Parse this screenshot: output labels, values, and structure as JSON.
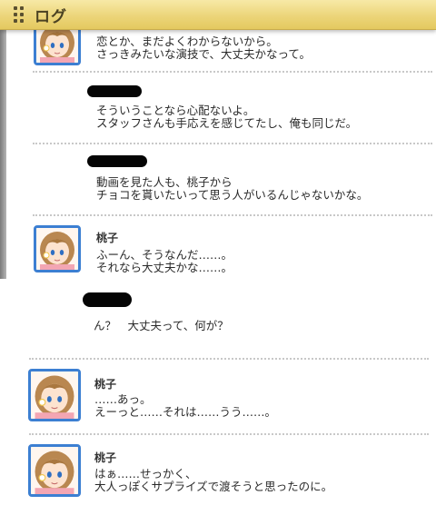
{
  "header": {
    "title": "ログ",
    "icon": "grip-icon"
  },
  "log": [
    {
      "speaker": "",
      "redacted": false,
      "avatar": true,
      "lines": [
        "恋とか、まだよくわからないから。",
        "さっきみたいな演技で、大丈夫かなって。"
      ]
    },
    {
      "speaker": "",
      "redacted": true,
      "avatar": false,
      "lines": [
        "そういうことなら心配ないよ。",
        "スタッフさんも手応えを感じてたし、俺も同じだ。"
      ]
    },
    {
      "speaker": "",
      "redacted": true,
      "avatar": false,
      "lines": [
        "動画を見た人も、桃子から",
        "チョコを貰いたいって思う人がいるんじゃないかな。"
      ]
    },
    {
      "speaker": "桃子",
      "redacted": false,
      "avatar": true,
      "lines": [
        "ふーん、そうなんだ……。",
        "それなら大丈夫かな……。"
      ]
    },
    {
      "speaker": "",
      "redacted": true,
      "avatar": false,
      "lines": [
        "ん？　大丈夫って、何が？"
      ]
    },
    {
      "speaker": "桃子",
      "redacted": false,
      "avatar": true,
      "lines": [
        "……あっ。",
        "えーっと……それは……うう……。"
      ]
    },
    {
      "speaker": "桃子",
      "redacted": false,
      "avatar": true,
      "lines": [
        "はぁ……せっかく、",
        "大人っぽくサプライズで渡そうと思ったのに。"
      ]
    }
  ],
  "colors": {
    "header": "#ecd57a",
    "avatar_border": "#3c7fd2",
    "separator": "#c8c8c8"
  }
}
